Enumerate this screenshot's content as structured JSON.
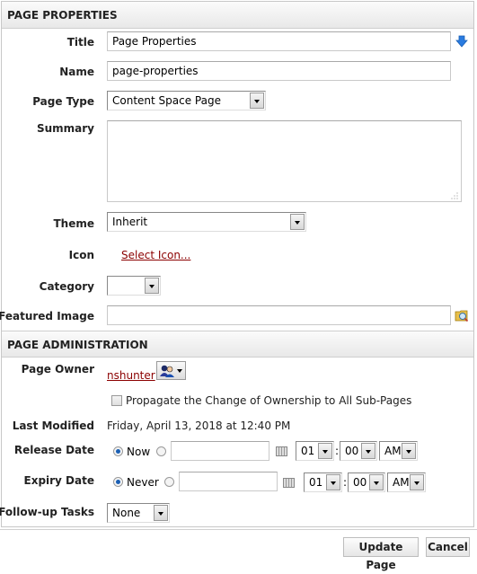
{
  "properties": {
    "header": "PAGE PROPERTIES",
    "title_label": "Title",
    "title_value": "Page Properties",
    "name_label": "Name",
    "name_value": "page-properties",
    "page_type_label": "Page Type",
    "page_type_value": "Content Space Page",
    "summary_label": "Summary",
    "summary_value": "",
    "theme_label": "Theme",
    "theme_value": "Inherit",
    "icon_label": "Icon",
    "icon_link": "Select Icon...",
    "category_label": "Category",
    "category_value": "",
    "featured_image_label": "Featured Image",
    "featured_image_value": ""
  },
  "administration": {
    "header": "PAGE ADMINISTRATION",
    "owner_label": "Page Owner",
    "owner_value": "nshunter",
    "propagate_label": "Propagate the Change of Ownership to All Sub-Pages",
    "propagate_checked": false,
    "last_modified_label": "Last Modified",
    "last_modified_value": "Friday, April 13, 2018 at 12:40 PM",
    "release": {
      "label": "Release Date",
      "option_label": "Now",
      "hour": "01",
      "sep": ":",
      "minute": "00",
      "ampm": "AM"
    },
    "expiry": {
      "label": "Expiry Date",
      "option_label": "Never",
      "hour": "01",
      "sep": ":",
      "minute": "00",
      "ampm": "AM"
    },
    "followup_label": "Follow-up Tasks",
    "followup_value": "None"
  },
  "buttons": {
    "update": "Update Page",
    "cancel": "Cancel"
  },
  "colors": {
    "link": "#8b0000",
    "accent_arrow": "#2a7be0"
  }
}
